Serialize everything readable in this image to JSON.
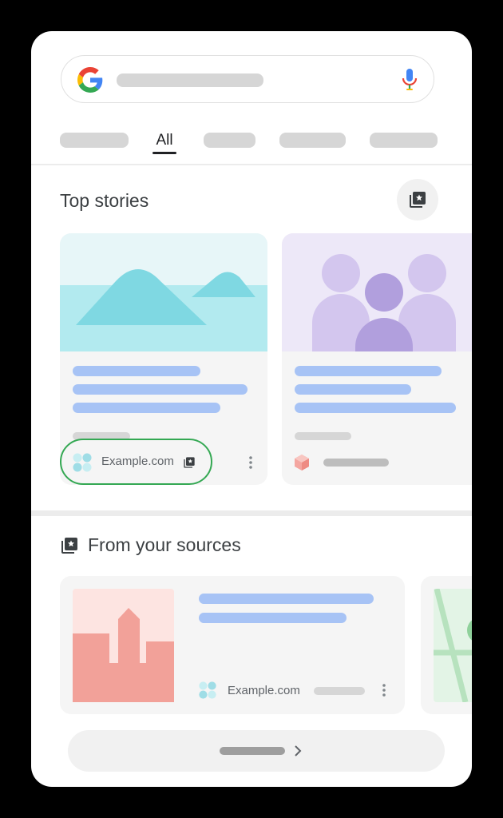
{
  "search": {
    "icon": "google-logo",
    "mic_icon": "microphone"
  },
  "tabs": {
    "active_label": "All"
  },
  "top_stories": {
    "title": "Top stories",
    "cards": [
      {
        "source": "Example.com"
      },
      {
        "source": ""
      }
    ]
  },
  "from_sources": {
    "title": "From your sources",
    "cards": [
      {
        "source": "Example.com"
      }
    ]
  },
  "colors": {
    "highlight": "#34a853",
    "placeholder_blue": "#a7c3f5",
    "placeholder_grey": "#d6d6d6"
  }
}
